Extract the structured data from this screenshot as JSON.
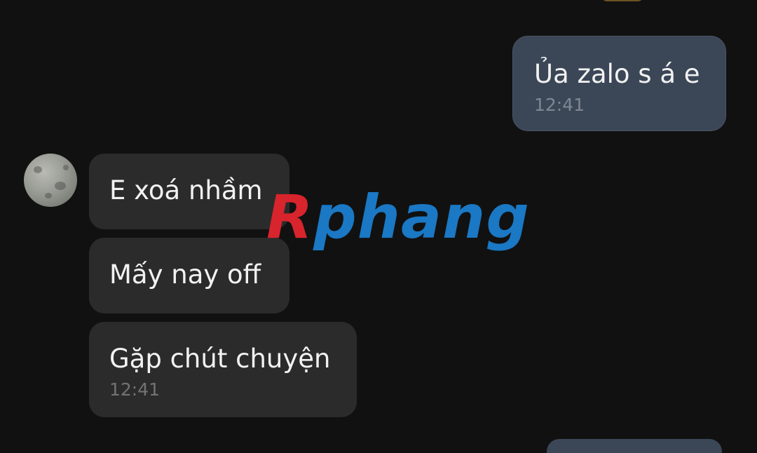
{
  "messages": [
    {
      "direction": "outgoing",
      "text": "Ủa zalo s á e",
      "time": "12:41"
    },
    {
      "direction": "incoming",
      "text": "E xoá nhầm"
    },
    {
      "direction": "incoming",
      "text": "Mấy nay off"
    },
    {
      "direction": "incoming",
      "text": "Gặp chút chuyện",
      "time": "12:41"
    }
  ],
  "watermark": {
    "first": "R",
    "rest": "phang"
  },
  "colors": {
    "background": "#111111",
    "outgoing_bubble": "#3b4757",
    "incoming_bubble": "#2b2b2b",
    "watermark_red": "#d8242c",
    "watermark_blue": "#1a78c4"
  }
}
